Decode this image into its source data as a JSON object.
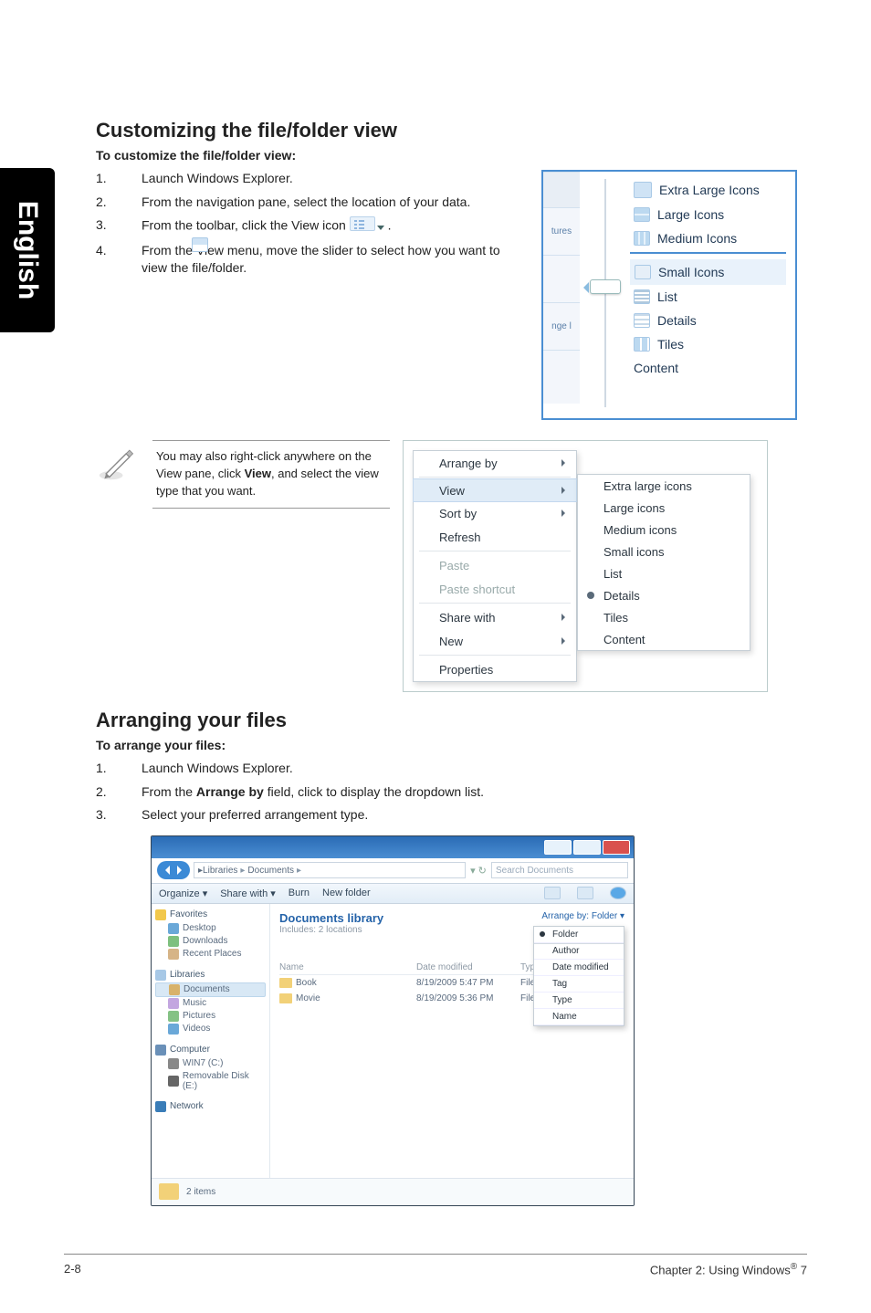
{
  "sidetab": {
    "label": "English"
  },
  "section1": {
    "title": "Customizing the file/folder view",
    "subhead": "To customize the file/folder view:",
    "steps": [
      {
        "num": "1.",
        "body": "Launch Windows Explorer."
      },
      {
        "num": "2.",
        "body": "From the navigation pane, select the location of your data."
      },
      {
        "num": "3.",
        "body_pre": "From the toolbar, click the View icon ",
        "body_post": "."
      },
      {
        "num": "4.",
        "body": "From the View menu, move the slider to select how you want to view the file/folder."
      }
    ]
  },
  "viewPanel": {
    "tabs": [
      "tures",
      "",
      "nge l"
    ],
    "items": [
      {
        "label": "Extra Large Icons",
        "iconClass": "xl"
      },
      {
        "label": "Large Icons",
        "iconClass": "large"
      },
      {
        "label": "Medium Icons",
        "iconClass": "med"
      },
      {
        "label": "Small Icons",
        "iconClass": "small"
      },
      {
        "label": "List",
        "iconClass": "list"
      },
      {
        "label": "Details",
        "iconClass": "details"
      },
      {
        "label": "Tiles",
        "iconClass": "tiles"
      },
      {
        "label": "Content",
        "iconClass": "content"
      }
    ]
  },
  "note": {
    "pre": "You may also right-click anywhere on the View pane, click ",
    "bold": "View",
    "post": ", and select the view type that you want."
  },
  "contextMenu": {
    "items": [
      {
        "label": "Arrange by",
        "arrow": true
      },
      {
        "label": "View",
        "arrow": true,
        "highlight": true
      },
      {
        "label": "Sort by",
        "arrow": true
      },
      {
        "label": "Refresh"
      },
      {
        "sep": true
      },
      {
        "label": "Paste",
        "disabled": true
      },
      {
        "label": "Paste shortcut",
        "disabled": true
      },
      {
        "sep": true
      },
      {
        "label": "Share with",
        "arrow": true
      },
      {
        "label": "New",
        "arrow": true
      },
      {
        "sep": true
      },
      {
        "label": "Properties"
      }
    ],
    "submenu": [
      {
        "label": "Extra large icons"
      },
      {
        "label": "Large icons"
      },
      {
        "label": "Medium icons"
      },
      {
        "label": "Small icons"
      },
      {
        "label": "List"
      },
      {
        "label": "Details",
        "selected": true
      },
      {
        "label": "Tiles"
      },
      {
        "label": "Content"
      }
    ]
  },
  "section2": {
    "title": "Arranging your files",
    "subhead": "To arrange your files:",
    "steps": [
      {
        "num": "1.",
        "body": "Launch Windows Explorer."
      },
      {
        "num": "2.",
        "pre": "From the ",
        "bold": "Arrange by",
        "post": " field, click to display the dropdown list."
      },
      {
        "num": "3.",
        "body": "Select your preferred arrangement type."
      }
    ]
  },
  "explorer": {
    "breadcrumb": [
      "Libraries",
      "Documents"
    ],
    "searchPlaceholder": "Search Documents",
    "menubar": {
      "organize": "Organize ▾",
      "share": "Share with ▾",
      "burn": "Burn",
      "newFolder": "New folder"
    },
    "sidebar": {
      "fav": {
        "hdr": "Favorites",
        "items": [
          "Desktop",
          "Downloads",
          "Recent Places"
        ]
      },
      "lib": {
        "hdr": "Libraries",
        "items": [
          "Documents",
          "Music",
          "Pictures",
          "Videos"
        ]
      },
      "comp": {
        "hdr": "Computer",
        "items": [
          "WIN7 (C:)",
          "Removable Disk (E:)"
        ]
      },
      "net": {
        "hdr": "Network"
      }
    },
    "libraryHeader": "Documents library",
    "librarySub": "Includes: 2 locations",
    "arrangeByLabel": "Arrange by:",
    "arrangeByValue": "Folder ▾",
    "dropdown": [
      "Folder",
      "Author",
      "Date modified",
      "Tag",
      "Type",
      "Name"
    ],
    "columns": [
      "Name",
      "Date modified",
      "Type"
    ],
    "rows": [
      {
        "name": "Book",
        "date": "8/19/2009 5:47 PM",
        "type": "File folder"
      },
      {
        "name": "Movie",
        "date": "8/19/2009 5:36 PM",
        "type": "File folder"
      }
    ],
    "status": "2 items"
  },
  "footer": {
    "left": "2-8",
    "right_pre": "Chapter 2: Using Windows",
    "right_sup": "®",
    "right_post": " 7"
  }
}
